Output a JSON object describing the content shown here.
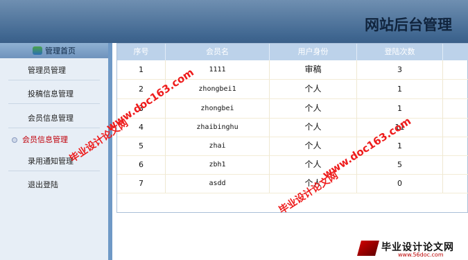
{
  "header": {
    "title": "网站后台管理"
  },
  "sidebar": {
    "home_label": "管理首页",
    "items": [
      {
        "label": "管理员管理"
      },
      {
        "label": "投稿信息管理"
      },
      {
        "label": "会员信息管理"
      },
      {
        "label": "会员信息管理",
        "active": true
      },
      {
        "label": "录用通知管理"
      },
      {
        "label": "退出登陆"
      }
    ]
  },
  "table": {
    "columns": [
      "序号",
      "会员名",
      "用户身份",
      "登陆次数"
    ],
    "rows": [
      [
        "1",
        "1111",
        "审稿",
        "3"
      ],
      [
        "2",
        "zhongbei1",
        "个人",
        "1"
      ],
      [
        "3",
        "zhongbei",
        "个人",
        "1"
      ],
      [
        "4",
        "zhaibinghu",
        "个人",
        "11"
      ],
      [
        "5",
        "zhai",
        "个人",
        "1"
      ],
      [
        "6",
        "zbh1",
        "个人",
        "5"
      ],
      [
        "7",
        "asdd",
        "个人",
        "0"
      ]
    ]
  },
  "watermark": {
    "url": "www.doc163.com",
    "cn": "毕业设计论文网",
    "footer_cn": "毕业设计论文网",
    "footer_url": "www.56doc.com"
  }
}
